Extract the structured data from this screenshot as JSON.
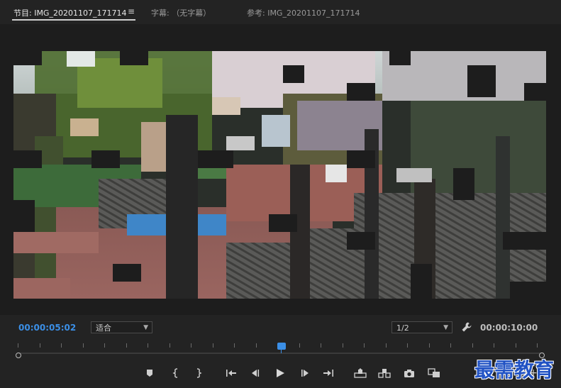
{
  "tabs": [
    {
      "label": "节目: IMG_20201107_171714",
      "active": true
    },
    {
      "label": "字幕: （无字幕）",
      "active": false
    },
    {
      "label": "参考: IMG_20201107_171714",
      "active": false
    }
  ],
  "tab_menu_icon": "≡",
  "timecode_current": "00:00:05:02",
  "timecode_duration": "00:00:10:00",
  "zoom_select": {
    "value": "适合"
  },
  "resolution_select": {
    "value": "1/2"
  },
  "watermark": "最需教育",
  "buttons": [
    {
      "name": "add-marker-button",
      "icon": "marker-icon"
    },
    {
      "name": "mark-in-button",
      "icon": "mark-in-icon"
    },
    {
      "name": "mark-out-button",
      "icon": "mark-out-icon"
    },
    {
      "name": "go-to-in-button",
      "icon": "go-to-in-icon"
    },
    {
      "name": "step-back-button",
      "icon": "step-back-icon"
    },
    {
      "name": "play-button",
      "icon": "play-icon"
    },
    {
      "name": "step-forward-button",
      "icon": "step-forward-icon"
    },
    {
      "name": "go-to-out-button",
      "icon": "go-to-out-icon"
    },
    {
      "name": "lift-button",
      "icon": "lift-icon"
    },
    {
      "name": "extract-button",
      "icon": "extract-icon"
    },
    {
      "name": "export-frame-button",
      "icon": "camera-icon"
    },
    {
      "name": "comparison-view-button",
      "icon": "compare-icon"
    }
  ],
  "colors": {
    "accent": "#3b8fe6",
    "panel": "#232323",
    "watermark": "#2253c4"
  }
}
